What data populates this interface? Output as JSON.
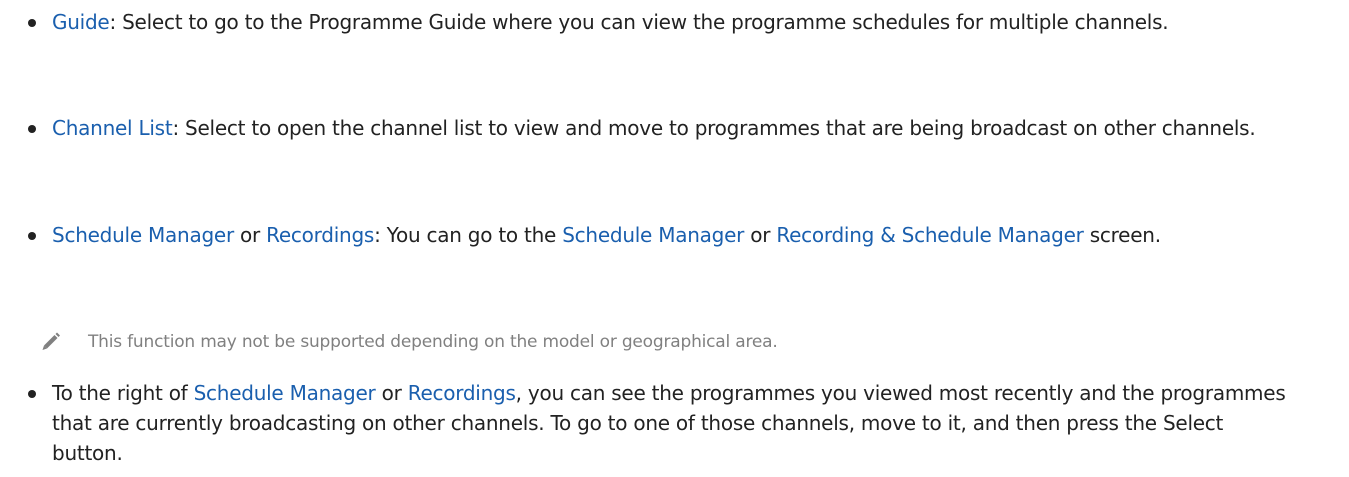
{
  "items": [
    {
      "term": "Guide",
      "sep": ": ",
      "text": "Select to go to the Programme Guide where you can view the programme schedules for multiple channels."
    },
    {
      "term": "Channel List",
      "sep": ": ",
      "text": "Select to open the channel list to view and move to programmes that are being broadcast on other channels."
    },
    {
      "term1": "Schedule Manager",
      "or1": " or ",
      "term2": "Recordings",
      "mid": ": You can go to the ",
      "term3": "Schedule Manager",
      "or2": " or ",
      "term4": "Recording & Schedule Manager",
      "end": " screen."
    },
    {
      "lead": "To the right of ",
      "term1": "Schedule Manager",
      "or1": " or ",
      "term2": "Recordings",
      "text": ", you can see the programmes you viewed most recently and the programmes that are currently broadcasting on other channels. To go to one of those channels, move to it, and then press the Select button."
    }
  ],
  "note": {
    "icon": "pencil-icon",
    "text": "This function may not be supported depending on the model or geographical area."
  },
  "colors": {
    "term": "#1a5fae",
    "body": "#222222",
    "note": "#808080"
  }
}
